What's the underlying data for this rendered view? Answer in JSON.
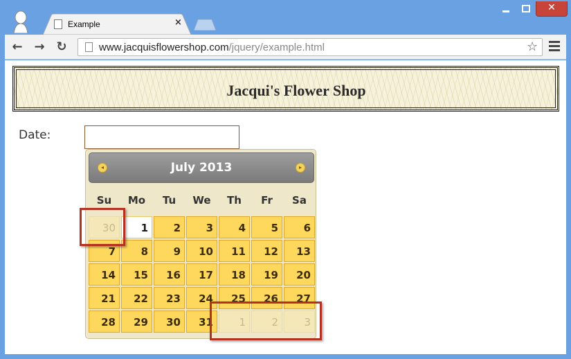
{
  "browser": {
    "tab_title": "Example",
    "tab_close": "×",
    "window_close": "✕",
    "url_host": "www.jacquisflowershop.com",
    "url_path": "/jquery/example.html",
    "star": "☆",
    "back": "←",
    "forward": "→",
    "reload": "↻"
  },
  "page": {
    "banner_title": "Jacqui's Flower Shop",
    "date_label": "Date:",
    "date_value": ""
  },
  "datepicker": {
    "title": "July 2013",
    "prev": "◂",
    "next": "▸",
    "weekdays": [
      "Su",
      "Mo",
      "Tu",
      "We",
      "Th",
      "Fr",
      "Sa"
    ],
    "weeks": [
      [
        "30",
        "1",
        "2",
        "3",
        "4",
        "5",
        "6"
      ],
      [
        "7",
        "8",
        "9",
        "10",
        "11",
        "12",
        "13"
      ],
      [
        "14",
        "15",
        "16",
        "17",
        "18",
        "19",
        "20"
      ],
      [
        "21",
        "22",
        "23",
        "24",
        "25",
        "26",
        "27"
      ],
      [
        "28",
        "29",
        "30",
        "31",
        "1",
        "2",
        "3"
      ]
    ],
    "other_month_cells": [
      "0.0",
      "4.4",
      "4.5",
      "4.6"
    ],
    "today_cell": "0.1",
    "colors": {
      "day_bg": "#fdd85d",
      "other_month_bg": "#f5e8b8",
      "header_bg": "#8c8c8c",
      "highlight": "#b5311f"
    }
  }
}
